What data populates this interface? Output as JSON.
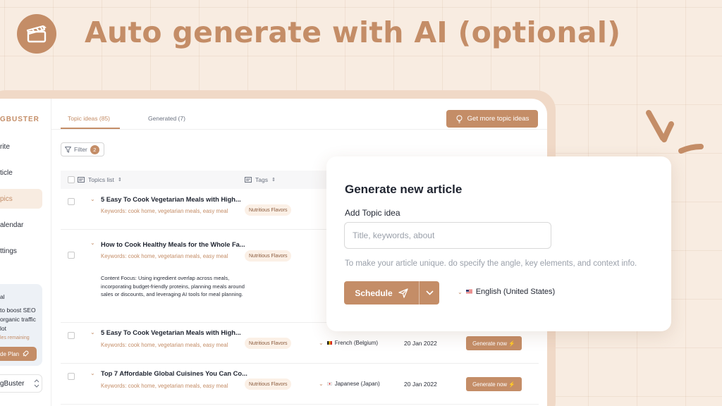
{
  "headline": "Auto generate with AI (optional)",
  "accent_color": "#c48d67",
  "background_color": "#f8ece1",
  "logo_icon": "clapperboard-icon",
  "sidebar": {
    "brand": "GBUSTER",
    "items": [
      {
        "label": "rite",
        "active": false
      },
      {
        "label": "ticle",
        "active": false
      },
      {
        "label": "pics",
        "active": true
      },
      {
        "label": "alendar",
        "active": false
      },
      {
        "label": "ttings",
        "active": false
      }
    ],
    "promo": {
      "title": "al",
      "desc_1": "to boost SEO",
      "desc_2": "organic traffic",
      "desc_3": "lot",
      "remaining": "les remaining",
      "button": "de Plan"
    },
    "workspace": "gBuster"
  },
  "tabs": [
    {
      "label": "Topic ideas (85)",
      "active": true
    },
    {
      "label": "Generated (7)",
      "active": false
    }
  ],
  "more_topics_button": "Get more topic ideas",
  "filter": {
    "label": "Filter",
    "count": "2"
  },
  "table": {
    "headers": {
      "topics": "Topics list",
      "tags": "Tags"
    },
    "rows": [
      {
        "title": "5 Easy To Cook Vegetarian Meals with High...",
        "keywords": "Keywords: cook home, vegetarian meals, easy meal",
        "tag": "Nutritious Flavors"
      },
      {
        "title": "How to Cook Healthy Meals for the Whole Fa...",
        "keywords": "Keywords: cook home, vegetarian meals, easy meal",
        "tag": "Nutritious Flavors",
        "description": "Content Focus: Using ingredient overlap across meals, incorporating budget-friendly proteins, planning meals around sales or discounts, and leveraging AI tools for meal planning."
      },
      {
        "title": "5 Easy To Cook Vegetarian Meals with High...",
        "keywords": "Keywords: cook home, vegetarian meals, easy meal",
        "tag": "Nutritious Flavors",
        "language": "French (Belgium)",
        "date": "20 Jan 2022",
        "action": "Generate now ⚡"
      },
      {
        "title": "Top 7 Affordable Global Cuisines You Can Co...",
        "keywords": "Keywords: cook home, vegetarian meals, easy meal",
        "tag": "Nutritious Flavors",
        "language": "Japanese (Japan)",
        "date": "20 Jan 2022",
        "action": "Generate now ⚡"
      }
    ]
  },
  "dialog": {
    "title": "Generate new article",
    "field_label": "Add Topic idea",
    "field_value": "",
    "field_placeholder": "Title, keywords, about",
    "hint": "To make your article unique. do specify the angle, key elements, and context info.",
    "schedule_button": "Schedule",
    "language": "English (United States)"
  }
}
